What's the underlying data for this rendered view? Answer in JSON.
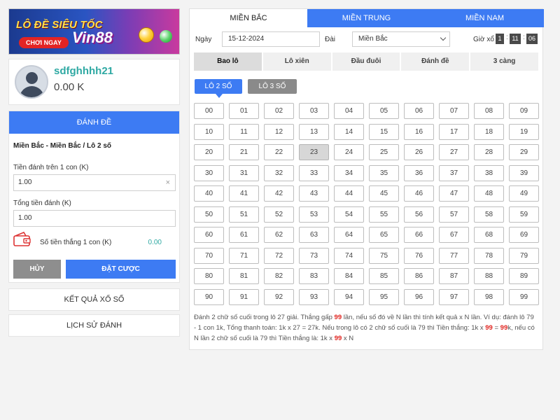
{
  "banner": {
    "title": "LÔ ĐỀ SIÊU TỐC",
    "button": "CHƠI NGAY",
    "brand": "Vin88"
  },
  "profile": {
    "username": "sdfghhhh21",
    "balance": "0.00 K"
  },
  "bet": {
    "header": "ĐÁNH ĐỀ",
    "breadcrumb": "Miền Bắc - Miền Bắc / Lô 2 số",
    "stake_label": "Tiền đánh trên 1 con (K)",
    "stake_value": "1.00",
    "clear_icon": "×",
    "total_label": "Tổng tiền đánh (K)",
    "total_value": "1.00",
    "win_label": "Số tiền thắng 1 con (K)",
    "win_value": "0.00",
    "cancel": "HỦY",
    "place": "ĐẶT CƯỢC"
  },
  "links": {
    "results": "KẾT QUẢ XỔ SỐ",
    "history": "LỊCH SỬ ĐÁNH"
  },
  "regions": [
    "MIỀN BẮC",
    "MIỀN TRUNG",
    "MIỀN NAM"
  ],
  "filters": {
    "date_label": "Ngày",
    "date_value": "15-12-2024",
    "station_label": "Đài",
    "station_value": "Miền Bắc",
    "time_label": "Giờ xổ",
    "hour": "1",
    "minute": "11",
    "second": "06"
  },
  "game_tabs": [
    "Bao lô",
    "Lô xiên",
    "Đầu đuôi",
    "Đánh đề",
    "3 càng"
  ],
  "sub_tabs": [
    "LÔ 2 SỐ",
    "LÔ 3 SỐ"
  ],
  "numbers": [
    "00",
    "01",
    "02",
    "03",
    "04",
    "05",
    "06",
    "07",
    "08",
    "09",
    "10",
    "11",
    "12",
    "13",
    "14",
    "15",
    "16",
    "17",
    "18",
    "19",
    "20",
    "21",
    "22",
    "23",
    "24",
    "25",
    "26",
    "27",
    "28",
    "29",
    "30",
    "31",
    "32",
    "33",
    "34",
    "35",
    "36",
    "37",
    "38",
    "39",
    "40",
    "41",
    "42",
    "43",
    "44",
    "45",
    "46",
    "47",
    "48",
    "49",
    "50",
    "51",
    "52",
    "53",
    "54",
    "55",
    "56",
    "57",
    "58",
    "59",
    "60",
    "61",
    "62",
    "63",
    "64",
    "65",
    "66",
    "67",
    "68",
    "69",
    "70",
    "71",
    "72",
    "73",
    "74",
    "75",
    "76",
    "77",
    "78",
    "79",
    "80",
    "81",
    "82",
    "83",
    "84",
    "85",
    "86",
    "87",
    "88",
    "89",
    "90",
    "91",
    "92",
    "93",
    "94",
    "95",
    "96",
    "97",
    "98",
    "99"
  ],
  "selected_number": "23",
  "note": {
    "p1": "Đánh 2 chữ số cuối trong lô 27 giải. Thắng gấp ",
    "h1": "99",
    "p2": " lần, nếu số đó về N lần thì tính kết quả x N lần. Ví dụ: đánh lô 79 - 1 con 1k, Tổng thanh toán: 1k x 27 = 27k. Nếu trong lô có 2 chữ số cuối là 79 thì Tiền thắng: 1k x ",
    "h2": "99",
    "p3": " = ",
    "h3": "99",
    "p4": "k, nếu có N lần 2 chữ số cuối là 79 thì Tiền thắng là: 1k x ",
    "h4": "99",
    "p5": " x N"
  },
  "colors": {
    "accent": "#3d7bf3",
    "username": "#2fa9a3",
    "highlight": "#e0241f"
  }
}
